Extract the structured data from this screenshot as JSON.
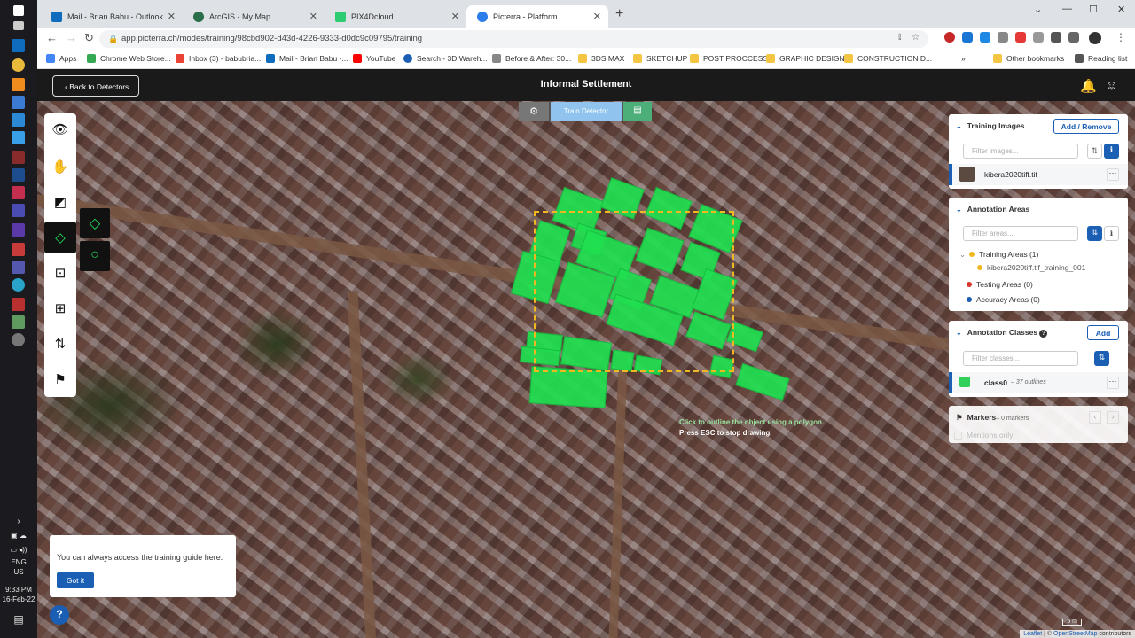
{
  "taskbar": {
    "lang": "ENG",
    "region": "US",
    "time": "9:33 PM",
    "date": "16-Feb-22"
  },
  "browser": {
    "tabs": [
      {
        "label": "Mail - Brian Babu - Outlook",
        "color": "#0f6cbd"
      },
      {
        "label": "ArcGIS - My Map",
        "color": "#2a6e4a"
      },
      {
        "label": "PIX4Dcloud",
        "color": "#2ecc71"
      },
      {
        "label": "Picterra - Platform",
        "color": "#2b7de9"
      }
    ],
    "url": "app.picterra.ch/modes/training/98cbd902-d43d-4226-9333-d0dc9c09795/training",
    "bookmarks": [
      {
        "label": "Apps",
        "color": "#4285f4"
      },
      {
        "label": "Chrome Web Store...",
        "color": "#34a853"
      },
      {
        "label": "Inbox (3) - babubria...",
        "color": "#ea4335"
      },
      {
        "label": "Mail - Brian Babu -...",
        "color": "#0f6cbd"
      },
      {
        "label": "YouTube",
        "color": "#ff0000"
      },
      {
        "label": "Search - 3D Wareh...",
        "color": "#1a5fb4"
      },
      {
        "label": "Before & After: 30...",
        "color": "#888888"
      },
      {
        "label": "3DS MAX",
        "color": "#f4c542"
      },
      {
        "label": "SKETCHUP",
        "color": "#f4c542"
      },
      {
        "label": "POST PROCCESS",
        "color": "#f4c542"
      },
      {
        "label": "GRAPHIC DESIGN",
        "color": "#f4c542"
      },
      {
        "label": "CONSTRUCTION D...",
        "color": "#f4c542"
      },
      {
        "label": "Other bookmarks",
        "color": "#f4c542"
      },
      {
        "label": "Reading list",
        "color": "#555555"
      }
    ],
    "bookmarks_overflow": "»"
  },
  "header": {
    "back_label": "‹ Back to Detectors",
    "title": "Informal Settlement"
  },
  "modebar": {
    "train_label": "Train Detector"
  },
  "canvas_hint": {
    "line1": "Click to outline the object using a polygon.",
    "line2": "Press ESC to stop drawing."
  },
  "panels": {
    "training_images": {
      "title": "Training Images",
      "action": "Add / Remove",
      "filter_placeholder": "Filter images...",
      "item": "kibera2020tiff.tif"
    },
    "annotation_areas": {
      "title": "Annotation Areas",
      "filter_placeholder": "Filter areas...",
      "training": "Training Areas (1)",
      "training_item": "kibera2020tiff.tif_training_001",
      "testing": "Testing Areas (0)",
      "accuracy": "Accuracy Areas (0)",
      "colors": {
        "training": "#f0b820",
        "testing": "#d9362b",
        "accuracy": "#1a5fb4"
      }
    },
    "annotation_classes": {
      "title": "Annotation Classes",
      "help": "?",
      "action": "Add",
      "filter_placeholder": "Filter classes...",
      "class_name": "class0",
      "class_meta": "– 37 outlines",
      "class_color": "#2fd15a"
    },
    "markers": {
      "title": "Markers",
      "meta": "– 0 markers",
      "mentions": "Mentions only"
    }
  },
  "toast": {
    "text": "You can always access the training guide here.",
    "button": "Got it"
  },
  "map": {
    "attrib_leaflet": "Leaflet",
    "attrib_osm": "OpenStreetMap",
    "attrib_sep": " | © ",
    "attrib_rest": " contributors",
    "scale": "5 m"
  }
}
